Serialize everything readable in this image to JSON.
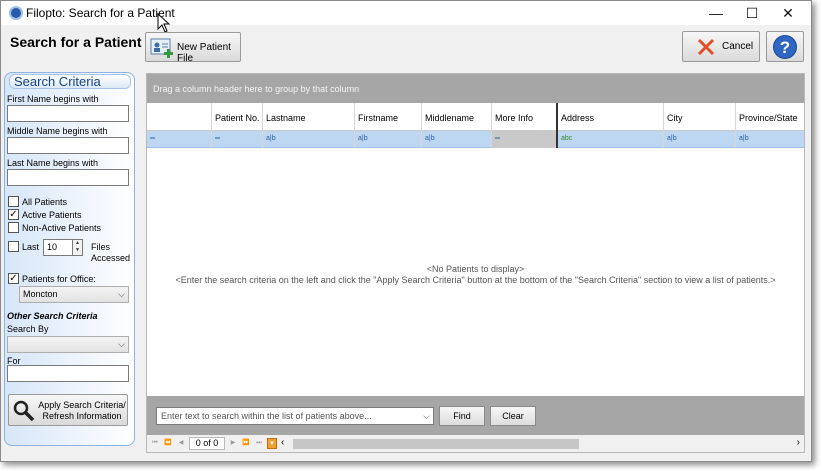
{
  "window": {
    "title": "Filopto: Search for a Patient",
    "minimize": "—",
    "maximize": "☐",
    "close": "✕"
  },
  "header": {
    "title": "Search for a Patient"
  },
  "toolbar": {
    "new_patient_label": "New Patient File",
    "cancel_label": "Cancel",
    "help_label": "?"
  },
  "criteria": {
    "title": "Search Criteria",
    "first_name_label": "First Name begins with",
    "first_name_value": "",
    "middle_name_label": "Middle Name begins with",
    "middle_name_value": "",
    "last_name_label": "Last Name begins with",
    "last_name_value": "",
    "all_patients_label": "All Patients",
    "all_patients_checked": false,
    "active_patients_label": "Active Patients",
    "active_patients_checked": true,
    "non_active_label": "Non-Active Patients",
    "non_active_checked": false,
    "last_label": "Last",
    "last_checked": false,
    "last_value": "10",
    "files_accessed_label": "Files Accessed",
    "office_label": "Patients for Office:",
    "office_checked": true,
    "office_value": "Moncton",
    "other_title": "Other Search Criteria",
    "search_by_label": "Search By",
    "search_by_value": "",
    "for_label": "For",
    "for_value": "",
    "apply_label": "Apply Search Criteria/ Refresh Information"
  },
  "grid": {
    "group_hint": "Drag a column header here to group by that column",
    "columns": [
      "",
      "Patient No.",
      "Lastname",
      "Firstname",
      "Middlename",
      "More Info",
      "Address",
      "City",
      "Province/State"
    ],
    "filter_cells": [
      "═",
      "═",
      "a|b",
      "a|b",
      "a|b",
      "═",
      "abc",
      "a|b",
      "a|b"
    ],
    "empty_message": "<No Patients to display>",
    "hint_message": "<Enter the search criteria on the left and click the \"Apply Search Criteria\" button at the bottom of the \"Search Criteria\" section to view a list of patients.>",
    "search_placeholder": "Enter text to search within the list of patients above...",
    "find_label": "Find",
    "clear_label": "Clear",
    "pager": "0 of 0"
  },
  "colors": {
    "accent": "#15428b",
    "selection": "#bdd7f3",
    "group_bar": "#a6a6a6"
  }
}
